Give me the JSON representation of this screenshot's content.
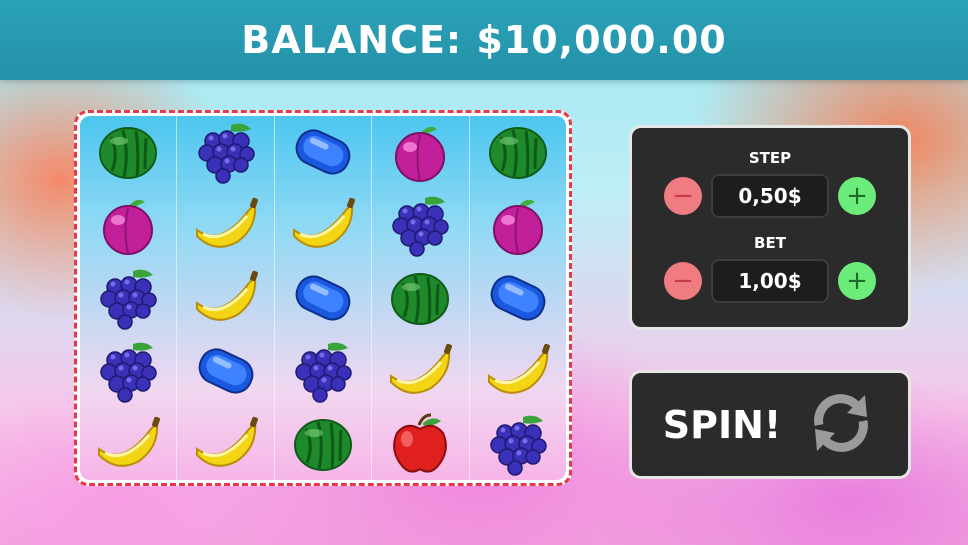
{
  "header": {
    "balance": "BALANCE: $10,000.00"
  },
  "reels": [
    [
      "watermelon",
      "plum",
      "grapes",
      "grapes",
      "banana"
    ],
    [
      "grapes",
      "banana",
      "banana",
      "blue-candy",
      "banana"
    ],
    [
      "blue-candy",
      "banana",
      "blue-candy",
      "grapes",
      "watermelon"
    ],
    [
      "plum",
      "grapes",
      "watermelon",
      "banana",
      "apple"
    ],
    [
      "watermelon",
      "plum",
      "blue-candy",
      "banana",
      "grapes"
    ]
  ],
  "controls": {
    "step_label": "STEP",
    "step_value": "0,50$",
    "bet_label": "BET",
    "bet_value": "1,00$",
    "minus": "−",
    "plus": "+"
  },
  "spin": {
    "label": "SPIN!",
    "icon": "refresh-icon"
  },
  "colors": {
    "header": "#2aa2b8",
    "panel": "#2b2b2b",
    "minus": "#f07b80",
    "plus": "#6cec7a",
    "frame": "#e23a4b"
  }
}
